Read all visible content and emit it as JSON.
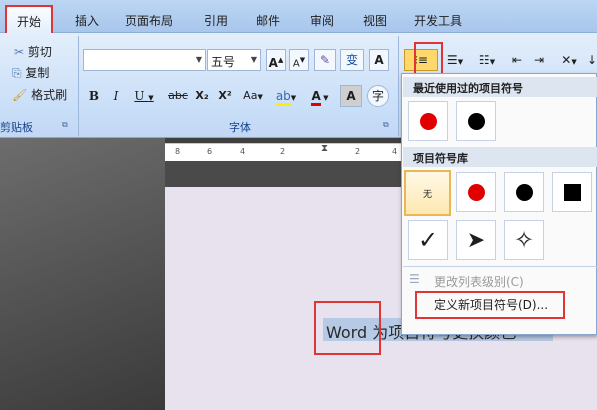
{
  "tabs": [
    "开始",
    "插入",
    "页面布局",
    "引用",
    "邮件",
    "审阅",
    "视图",
    "开发工具"
  ],
  "clipboard": {
    "cut": "剪切",
    "copy": "复制",
    "format_painter": "格式刷",
    "group_label": "剪贴板"
  },
  "font": {
    "name_value": "",
    "size_value": "五号",
    "group_label": "字体",
    "grow": "A",
    "shrink": "A",
    "phonetic": "变",
    "bold": "B",
    "italic": "I",
    "underline": "U",
    "strike": "abc",
    "subscript": "X₂",
    "superscript": "X²",
    "change_case": "Aa",
    "font_color": "A",
    "char_shading": "A",
    "enclose": "字"
  },
  "ruler": {
    "ticks": [
      "8",
      "6",
      "4",
      "2",
      "2",
      "4",
      "6"
    ]
  },
  "dropdown": {
    "recent_header": "最近使用过的项目符号",
    "library_header": "项目符号库",
    "none_label": "无",
    "change_level": "更改列表级别(C)",
    "define_new": "定义新项目符号(D)..."
  },
  "document": {
    "text": "Word 为项目符号更换颜色"
  },
  "colors": {
    "bullet_red": "#e00000",
    "bullet_black": "#000000",
    "highlight": "#e03535"
  }
}
